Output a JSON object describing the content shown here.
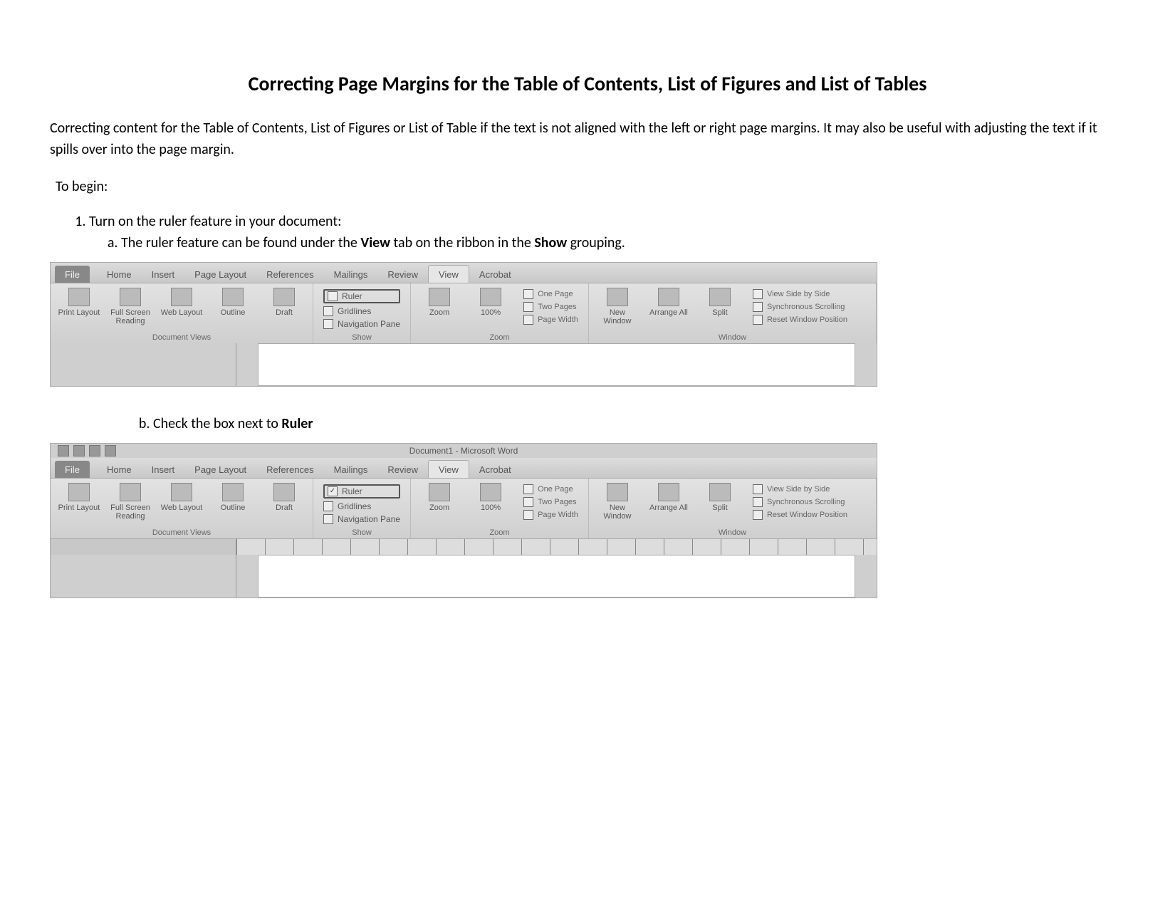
{
  "title": "Correcting Page Margins for the Table of Contents, List of Figures and List of Tables",
  "intro": "Correcting content for the Table of Contents, List of Figures or List of Table if the text is not aligned with the left or right page margins. It may also be useful with adjusting the text if it spills over into the page margin.",
  "to_begin": "To begin:",
  "step1": "Turn on the ruler feature in your document:",
  "step1a_pre": "The ruler feature can be found under the ",
  "step1a_bold1": "View",
  "step1a_mid": " tab on the ribbon in the ",
  "step1a_bold2": "Show",
  "step1a_post": " grouping.",
  "step1b_pre": "Check the box next to ",
  "step1b_bold": "Ruler",
  "ribbon_title": "Document1 - Microsoft Word",
  "tabs": {
    "file": "File",
    "home": "Home",
    "insert": "Insert",
    "page_layout": "Page Layout",
    "references": "References",
    "mailings": "Mailings",
    "review": "Review",
    "view": "View",
    "acrobat": "Acrobat"
  },
  "doc_views": {
    "print_layout": "Print Layout",
    "full_screen": "Full Screen Reading",
    "web_layout": "Web Layout",
    "outline": "Outline",
    "draft": "Draft",
    "label": "Document Views"
  },
  "show": {
    "ruler": "Ruler",
    "gridlines": "Gridlines",
    "nav_pane": "Navigation Pane",
    "label": "Show"
  },
  "zoom": {
    "zoom": "Zoom",
    "hundred": "100%",
    "one_page": "One Page",
    "two_pages": "Two Pages",
    "page_width": "Page Width",
    "label": "Zoom"
  },
  "window": {
    "new_window": "New Window",
    "arrange_all": "Arrange All",
    "split": "Split",
    "side_by_side": "View Side by Side",
    "sync_scroll": "Synchronous Scrolling",
    "reset_pos": "Reset Window Position",
    "label": "Window"
  }
}
